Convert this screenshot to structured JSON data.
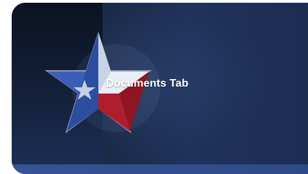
{
  "card": {
    "title": "Documents Tab",
    "icon": "texas-star-icon"
  },
  "colors": {
    "star_blue": "#2c4da0",
    "star_red": "#b01e2d",
    "star_white": "#e9eef7",
    "card_dark": "#0f1a2e",
    "card_mid": "#1f325a",
    "band": "#3b5aa0"
  }
}
